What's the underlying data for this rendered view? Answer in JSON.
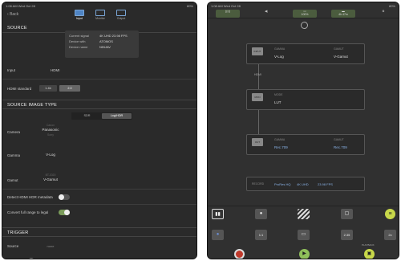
{
  "left": {
    "status": {
      "time": "1:08 AM  Wed Oct 28",
      "battery": "80%"
    },
    "back_label": "Back",
    "tabs": [
      {
        "label": "Input"
      },
      {
        "label": "Monitor"
      },
      {
        "label": "Output"
      }
    ],
    "source_title": "SOURCE",
    "info": {
      "signal_label": "Current signal",
      "signal_value": "4K UHD  23.98 FPS",
      "device_with_label": "Device with",
      "device_with_value": "ATOMOS",
      "device_name_label": "Device name",
      "device_name_value": "NINJAV"
    },
    "input_label": "Input",
    "input_value": "HDMI",
    "hdmi_standard_label": "HDMI standard",
    "hdmi_options": [
      "1.4b",
      "2.0"
    ],
    "source_image_title": "SOURCE IMAGE TYPE",
    "image_type_options": [
      "SDR",
      "Log/HDR"
    ],
    "camera_label": "Camera",
    "camera_above": "Canon",
    "camera_value": "Panasonic",
    "camera_below": "Sony",
    "gamma_label": "Gamma",
    "gamma_value": "V-Log",
    "gamut_label": "Gamut",
    "gamut_above": "BT.2020",
    "gamut_value": "V-Gamut",
    "detect_label": "Detect HDMI HDR metadata",
    "convert_label": "Convert full range to legal",
    "trigger_title": "TRIGGER",
    "source_label": "Source",
    "source_value": "none"
  },
  "right": {
    "status": {
      "time": "1:08 AM  Wed Oct 28",
      "battery": "80%"
    },
    "top_buttons": [
      {
        "label": ""
      },
      {
        "label": ""
      },
      {
        "label": "100%"
      },
      {
        "label": "4h 47m"
      },
      {
        "label": ""
      }
    ],
    "box1": {
      "chip": "INPUT",
      "gamma_label": "GAMMA",
      "gamma_value": "V-Log",
      "gamut_label": "GAMUT",
      "gamut_value": "V-Gamut"
    },
    "hdmi_label": "HDMI",
    "box2": {
      "chip": "MON",
      "mode_label": "MODE",
      "mode_value": "LUT"
    },
    "box3": {
      "chip": "OUT",
      "gamma_label": "GAMMA",
      "gamma_value": "Rec.709",
      "gamut_label": "GAMUT",
      "gamut_value": "Rec.709"
    },
    "record": {
      "label": "RECORD",
      "codec": "ProRes HQ",
      "res": "4K UHD",
      "fps": "23.98 FPS"
    },
    "bottom_tools": {
      "zoom": "1:1",
      "ratio": "2.35",
      "scale": "2x",
      "playback_label": "PLAYBACK"
    }
  }
}
